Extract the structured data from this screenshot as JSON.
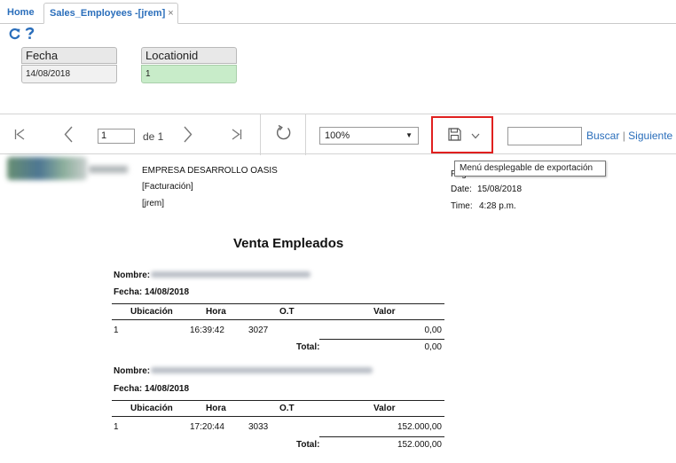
{
  "tabs": [
    {
      "label": "Home"
    },
    {
      "label": "Sales_Employees -[jrem]",
      "close": "×"
    }
  ],
  "params": {
    "fecha": {
      "label": "Fecha",
      "value": "14/08/2018"
    },
    "locationid": {
      "label": "Locationid",
      "value": "1"
    }
  },
  "toolbar": {
    "page_value": "1",
    "page_of": "de 1",
    "zoom": "100%",
    "search_label": "Buscar",
    "search_sep": "|",
    "next_label": "Siguiente",
    "export_tooltip": "Menú desplegable de exportación"
  },
  "report": {
    "company": "EMPRESA DESARROLLO OASIS",
    "line2": "[Facturación]",
    "line3": "[jrem]",
    "page_label": "Pag",
    "date_label": "Date:",
    "date_value": "15/08/2018",
    "time_label": "Time:",
    "time_value": "4:28 p.m.",
    "title": "Venta Empleados",
    "nombre_label": "Nombre:",
    "fecha_label": "Fecha: 14/08/2018",
    "columns": [
      "Ubicación",
      "Hora",
      "O.T",
      "Valor"
    ],
    "total_label": "Total:",
    "groups": [
      {
        "row": {
          "ubicacion": "1",
          "hora": "16:39:42",
          "ot": "3027",
          "valor": "0,00"
        },
        "total": "0,00"
      },
      {
        "row": {
          "ubicacion": "1",
          "hora": "17:20:44",
          "ot": "3033",
          "valor": "152.000,00"
        },
        "total": "152.000,00"
      }
    ]
  },
  "colors": {
    "accent": "#2a6ebb",
    "highlight_border": "#e0201f",
    "param_green": "#c8ecc9"
  },
  "icons": [
    "refresh-icon",
    "help-icon",
    "first-page-icon",
    "prev-page-icon",
    "next-page-icon",
    "last-page-icon",
    "reload-icon",
    "save-icon",
    "chevron-down-icon"
  ]
}
